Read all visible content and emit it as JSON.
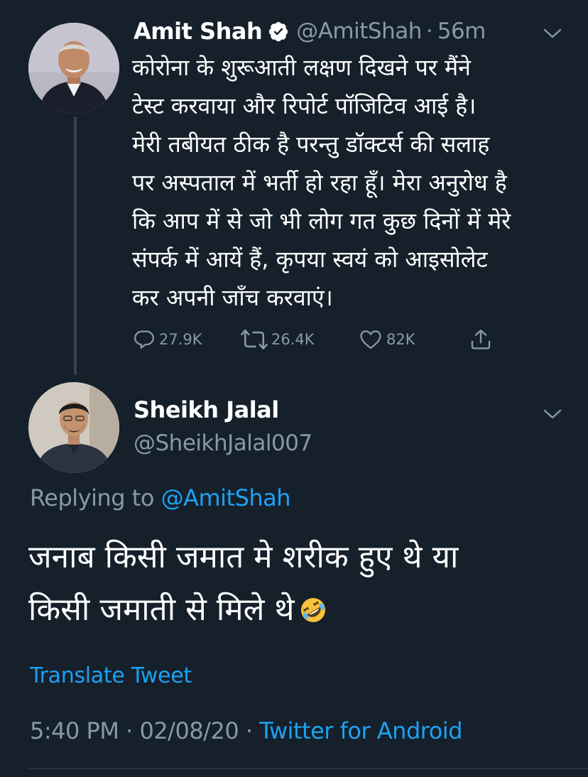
{
  "original_tweet": {
    "display_name": "Amit Shah",
    "handle": "@AmitShah",
    "separator": "·",
    "time": "56m",
    "verified": true,
    "text": "कोरोना के शुरूआती लक्षण दिखने पर मैंने\nटेस्ट करवाया और रिपोर्ट पॉजिटिव आई है।\nमेरी तबीयत ठीक है परन्तु डॉक्टर्स की सलाह\nपर अस्पताल में भर्ती हो रहा हूँ। मेरा अनुरोध है\nकि आप में से जो भी लोग गत कुछ दिनों में मेरे\nसंपर्क में आयें हैं, कृपया स्वयं को आइसोलेट\nकर अपनी जाँच करवाएं।",
    "actions": {
      "reply_count": "27.9K",
      "retweet_count": "26.4K",
      "like_count": "82K"
    }
  },
  "reply": {
    "display_name": "Sheikh Jalal",
    "handle": "@SheikhJalal007",
    "replying_prefix": "Replying to",
    "replying_to": "@AmitShah",
    "text": "जनाब किसी जमात मे शरीक हुए थे या\nकिसी जमाती से मिले थे",
    "emoji": "rolling-on-the-floor-laughing",
    "translate_label": "Translate Tweet",
    "time": "5:40 PM",
    "separator": "·",
    "date": "02/08/20",
    "source": "Twitter for Android"
  },
  "colors": {
    "background": "#15202b",
    "primary_text": "#ffffff",
    "secondary_text": "#8899a6",
    "accent": "#1da1f2",
    "thread_line": "#38444d"
  }
}
